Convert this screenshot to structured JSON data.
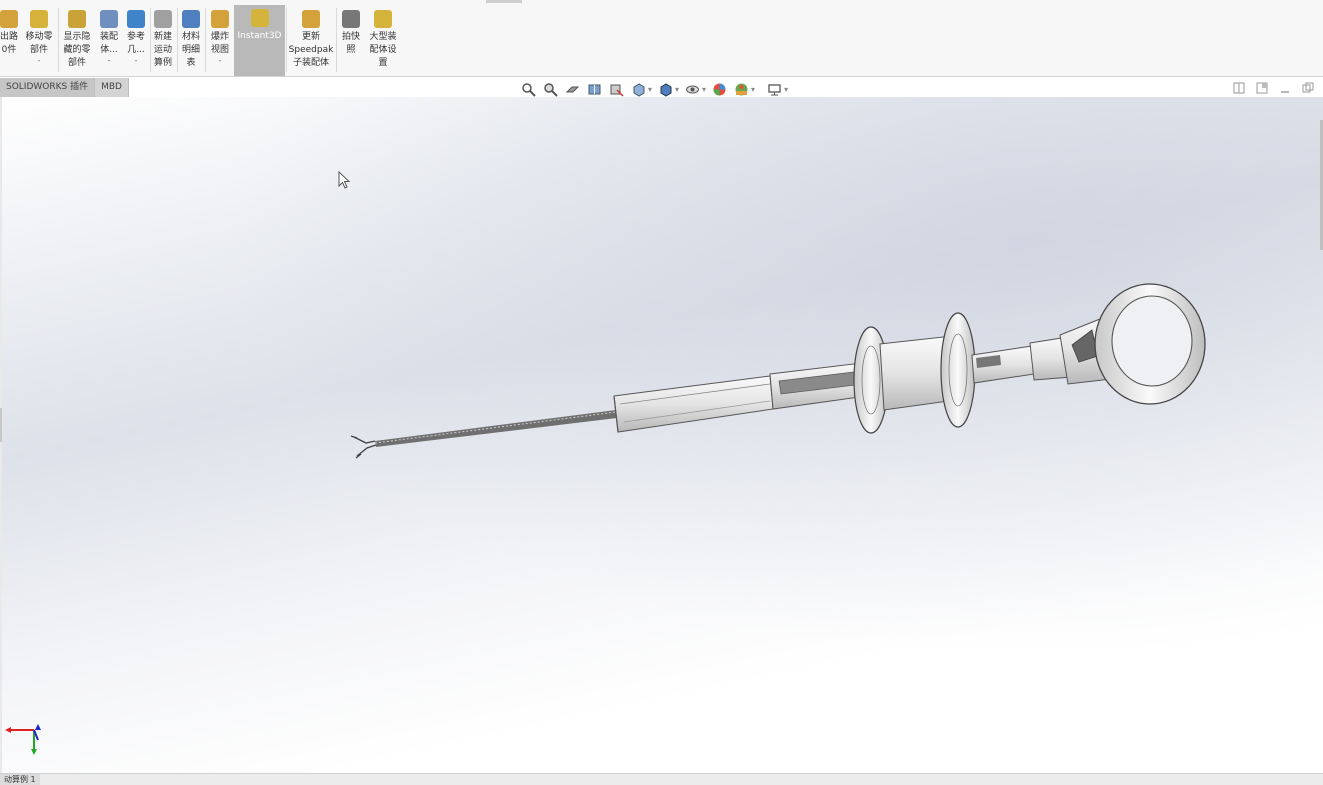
{
  "ribbon": {
    "buttons": [
      {
        "label": "出路\n0件",
        "icon": "assembly-icon",
        "color": "#d4a23a"
      },
      {
        "label": "移动零\n部件",
        "caret": "-",
        "icon": "move-component-icon",
        "color": "#d6b23a"
      },
      {
        "label": "显示隐\n藏的零\n部件",
        "icon": "show-hidden-icon",
        "color": "#c9a23a"
      },
      {
        "label": "装配\n体...",
        "caret": "-",
        "icon": "assembly-feature-icon",
        "color": "#6f8fbf"
      },
      {
        "label": "参考\n几...",
        "caret": "-",
        "icon": "reference-geometry-icon",
        "color": "#3f83c8"
      },
      {
        "label": "新建\n运动\n算例",
        "icon": "motion-study-icon",
        "color": "#a0a0a0"
      },
      {
        "label": "材料\n明细\n表",
        "icon": "bom-icon",
        "color": "#4f7fbf"
      },
      {
        "label": "爆炸\n视图",
        "caret": "-",
        "icon": "exploded-view-icon",
        "color": "#d4a23a"
      },
      {
        "label": "Instant3D",
        "icon": "instant3d-icon",
        "color": "#d4b43a",
        "active": true
      },
      {
        "label": "更新\nSpeedpak\n子装配体",
        "icon": "speedpak-icon",
        "color": "#d4a23a"
      },
      {
        "label": "拍快\n照",
        "icon": "snapshot-icon",
        "color": "#777777"
      },
      {
        "label": "大型装\n配体设\n置",
        "icon": "large-assembly-icon",
        "color": "#d4b43a"
      }
    ]
  },
  "tabs": [
    {
      "label": "SOLIDWORKS 插件"
    },
    {
      "label": "MBD"
    }
  ],
  "heads_up_toolbar": {
    "icons": [
      "zoom-to-fit-icon",
      "zoom-area-icon",
      "previous-view-icon",
      "section-view-icon",
      "dynamic-annotation-icon",
      "view-orientation-icon",
      "display-style-icon",
      "hide-show-icon",
      "edit-appearance-icon",
      "apply-scene-icon",
      "view-settings-icon"
    ]
  },
  "window_controls": [
    "tile-icon",
    "restore-icon",
    "minimize-icon",
    "maximize-icon"
  ],
  "statusbar": {
    "tab_label": "动算例 1"
  },
  "colors": {
    "ribbon_bg": "#f7f7f7",
    "active_button": "#b9b9b9",
    "viewport_bg": "#dde1e9",
    "model_metal": "#e6e6e6"
  }
}
